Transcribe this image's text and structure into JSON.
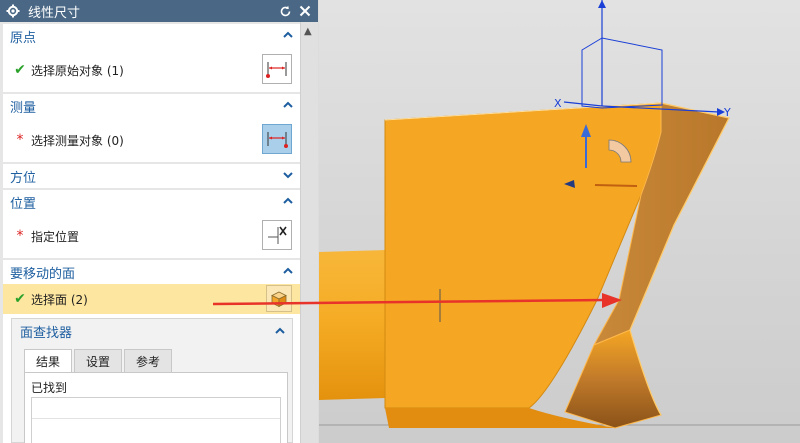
{
  "dialog": {
    "title": "线性尺寸",
    "sections": {
      "origin": {
        "header": "原点",
        "row_label": "选择原始对象 (1)"
      },
      "measure": {
        "header": "测量",
        "row_label": "选择测量对象 (0)"
      },
      "orientation": {
        "header": "方位"
      },
      "location": {
        "header": "位置",
        "row_label": "指定位置"
      },
      "move_faces": {
        "header": "要移动的面",
        "row_label": "选择面 (2)",
        "finder": {
          "header": "面查找器",
          "tabs": [
            "结果",
            "设置",
            "参考"
          ],
          "active_tab": "结果",
          "found_label": "已找到"
        }
      }
    }
  },
  "viewport": {
    "axis_labels": {
      "x": "X",
      "y": "Y"
    }
  },
  "colors": {
    "titlebar": "#4a6885",
    "section_header_text": "#1f5fa0",
    "part_orange": "#f5a623",
    "selection_highlight": "#fde6a0",
    "callout_arrow": "#e8332a",
    "axis_blue": "#1a3fd6",
    "check_green": "#2aa22a",
    "required_star": "#d22222"
  }
}
